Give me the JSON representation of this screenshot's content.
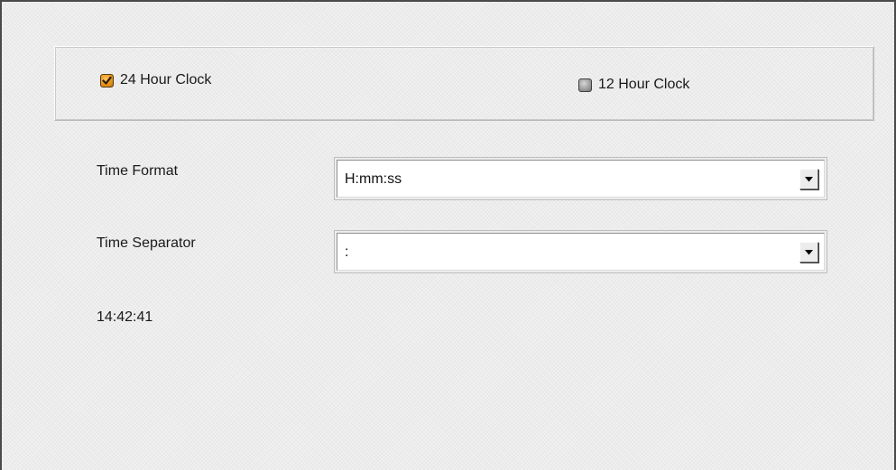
{
  "clock_mode": {
    "options": [
      {
        "label": "24 Hour Clock",
        "checked": true,
        "icon": "checked-box-icon"
      },
      {
        "label": "12 Hour Clock",
        "checked": false,
        "icon": "unchecked-box-icon"
      }
    ]
  },
  "time_format": {
    "label": "Time Format",
    "value": "H:mm:ss",
    "icon": "chevron-down-icon"
  },
  "time_separator": {
    "label": "Time Separator",
    "value": ":",
    "icon": "chevron-down-icon"
  },
  "current_time": "14:42:41",
  "colors": {
    "checked_accent": "#e08a12",
    "panel_background": "#ececec",
    "border_dark": "#4a4a4a"
  }
}
